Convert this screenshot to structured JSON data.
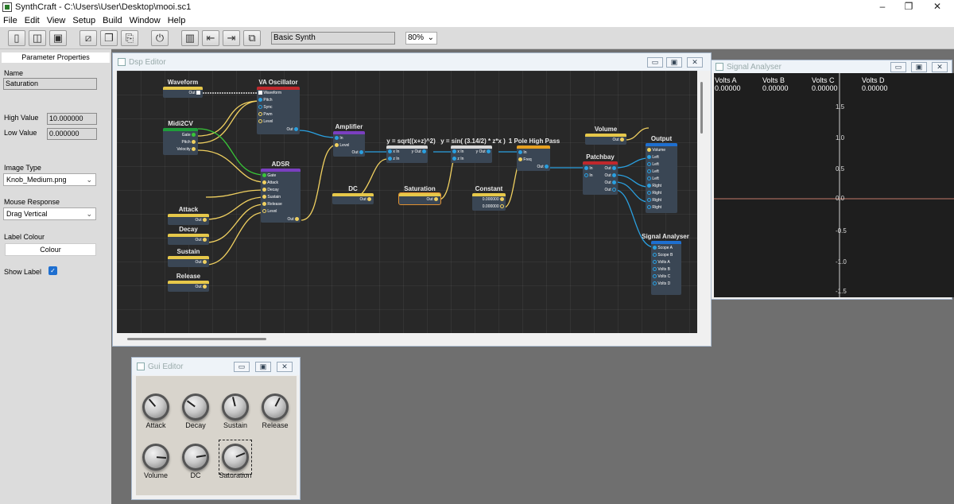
{
  "app": {
    "title": "SynthCraft - C:\\Users\\User\\Desktop\\mooi.sc1",
    "window_controls": {
      "minimize": "–",
      "maximize": "❐",
      "close": "✕"
    }
  },
  "menu": [
    "File",
    "Edit",
    "View",
    "Setup",
    "Build",
    "Window",
    "Help"
  ],
  "toolbar": {
    "buttons": [
      "new-file-icon",
      "open-icon",
      "save-icon",
      "cut-icon",
      "copy-icon",
      "paste-icon",
      "power-icon",
      "panel-icon",
      "import-icon",
      "export-icon",
      "duplicate-icon"
    ],
    "preset_name": "Basic Synth",
    "zoom": "80%"
  },
  "properties": {
    "header": "Parameter Properties",
    "name_label": "Name",
    "name_value": "Saturation",
    "high_label": "High Value",
    "high_value": "10.000000",
    "low_label": "Low Value",
    "low_value": "0.000000",
    "image_type_label": "Image Type",
    "image_type_value": "Knob_Medium.png",
    "mouse_label": "Mouse Response",
    "mouse_value": "Drag Vertical",
    "label_colour_label": "Label Colour",
    "colour_button": "Colour",
    "show_label": "Show Label",
    "show_label_checked": true
  },
  "dsp_editor": {
    "title": "Dsp Editor",
    "nodes": {
      "waveform": {
        "title": "Waveform",
        "ports": [
          "Out"
        ]
      },
      "midi2cv": {
        "title": "Midi2CV",
        "ports": [
          "Gate",
          "Pitch",
          "Velocity"
        ]
      },
      "va_osc": {
        "title": "VA Oscillator",
        "inputs": [
          "Waveform",
          "Pitch",
          "Sync",
          "Pwm",
          "Level"
        ],
        "out": "Out"
      },
      "adsr": {
        "title": "ADSR",
        "inputs": [
          "Gate",
          "Attack",
          "Decay",
          "Sustain",
          "Release",
          "Level"
        ],
        "out": "Out"
      },
      "attack": {
        "title": "Attack",
        "out": "Out"
      },
      "decay": {
        "title": "Decay",
        "out": "Out"
      },
      "sustain": {
        "title": "Sustain",
        "out": "Out"
      },
      "release": {
        "title": "Release",
        "out": "Out"
      },
      "amplifier": {
        "title": "Amplifier",
        "inputs": [
          "In",
          "Level"
        ],
        "out": "Out"
      },
      "dc": {
        "title": "DC",
        "out": "Out"
      },
      "sqrt": {
        "title": "y = sqrt((x+z)^2)",
        "inputs": [
          "x In",
          "z In"
        ],
        "out": "y Out"
      },
      "saturation": {
        "title": "Saturation",
        "out": "Out"
      },
      "sin": {
        "title": "y = sin( (3.14/2) * z*x )",
        "inputs": [
          "x In",
          "z In"
        ],
        "out": "y Out"
      },
      "constant": {
        "title": "Constant",
        "values": [
          "0.000000",
          "0.000000"
        ]
      },
      "highpass": {
        "title": "1 Pole High Pass",
        "inputs": [
          "In",
          "Freq"
        ],
        "out": "Out"
      },
      "volume": {
        "title": "Volume",
        "out": "Out"
      },
      "patchbay": {
        "title": "Patchbay",
        "inputs": [
          "In",
          "In"
        ],
        "outs": [
          "Out",
          "Out",
          "Out",
          "Out"
        ]
      },
      "output": {
        "title": "Output",
        "inputs": [
          "Volume",
          "Left",
          "Left",
          "Left",
          "Left",
          "Right",
          "Right",
          "Right",
          "Right"
        ]
      },
      "signal_an": {
        "title": "Signal Analyser",
        "inputs": [
          "Scope A",
          "Scope B",
          "Volts A",
          "Volts B",
          "Volts C",
          "Volts D"
        ]
      }
    }
  },
  "analyser": {
    "title": "Signal Analyser",
    "volts": [
      {
        "label": "Volts A",
        "value": "0.00000"
      },
      {
        "label": "Volts B",
        "value": "0.00000"
      },
      {
        "label": "Volts C",
        "value": "0.00000"
      },
      {
        "label": "Volts D",
        "value": "0.00000"
      }
    ],
    "y_ticks": [
      "1.5",
      "1.0",
      "0.5",
      "0.0",
      "-0.5",
      "-1.0",
      "-1.5"
    ]
  },
  "gui_editor": {
    "title": "Gui Editor",
    "knobs": [
      {
        "label": "Attack",
        "value": 0.35
      },
      {
        "label": "Decay",
        "value": 0.3
      },
      {
        "label": "Sustain",
        "value": 0.45
      },
      {
        "label": "Release",
        "value": 0.6
      },
      {
        "label": "Volume",
        "value": 0.85
      },
      {
        "label": "DC",
        "value": 0.8
      },
      {
        "label": "Saturation",
        "value": 0.75
      }
    ]
  }
}
